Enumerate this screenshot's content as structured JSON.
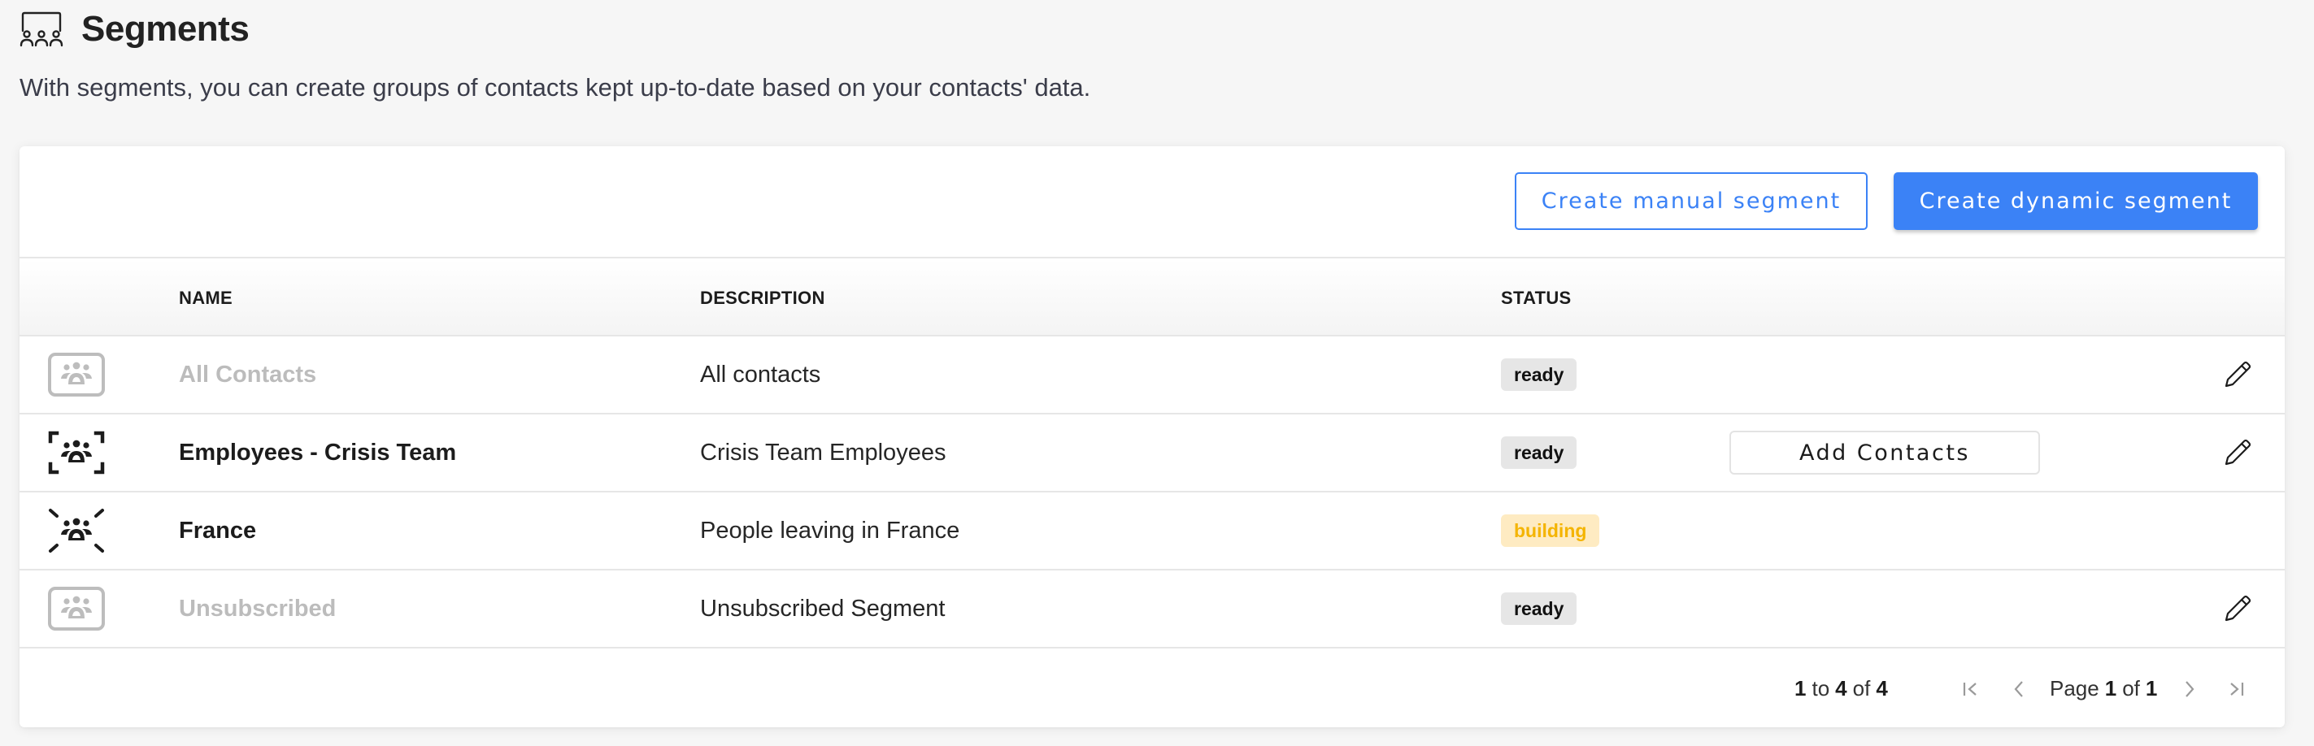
{
  "header": {
    "icon": "segments-icon",
    "title": "Segments",
    "subtitle": "With segments, you can create groups of contacts kept up-to-date based on your contacts' data."
  },
  "toolbar": {
    "create_manual_label": "Create manual segment",
    "create_dynamic_label": "Create dynamic segment"
  },
  "colors": {
    "accent": "#3b82f6",
    "ready_bg": "#e6e6e6",
    "building_bg": "#feebc2",
    "building_text": "#f4b400",
    "muted_text": "#bcbcbc"
  },
  "table": {
    "columns": [
      "NAME",
      "DESCRIPTION",
      "STATUS"
    ],
    "rows": [
      {
        "icon": "contacts-framed-icon",
        "name": "All Contacts",
        "muted": true,
        "description": "All contacts",
        "status": "ready",
        "action": null,
        "editable": true
      },
      {
        "icon": "contacts-focus-icon",
        "name": "Employees - Crisis Team",
        "muted": false,
        "description": "Crisis Team Employees",
        "status": "ready",
        "action": "Add Contacts",
        "editable": true
      },
      {
        "icon": "contacts-dynamic-icon",
        "name": "France",
        "muted": false,
        "description": "People leaving in France",
        "status": "building",
        "action": null,
        "editable": false
      },
      {
        "icon": "contacts-framed-icon",
        "name": "Unsubscribed",
        "muted": true,
        "description": "Unsubscribed Segment",
        "status": "ready",
        "action": null,
        "editable": true
      }
    ]
  },
  "pagination": {
    "from": "1",
    "to_word": "to",
    "to": "4",
    "of_word": "of",
    "total": "4",
    "page_word": "Page",
    "page": "1",
    "page_of_word": "of",
    "page_count": "1"
  }
}
